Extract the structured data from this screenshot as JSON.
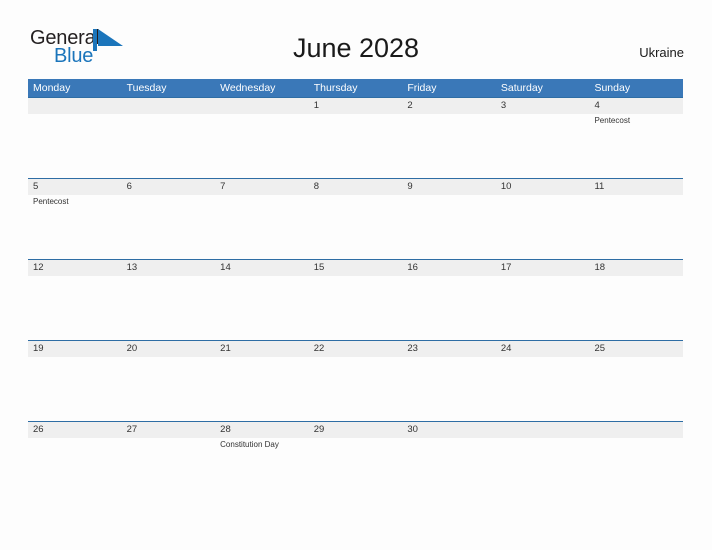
{
  "logo": {
    "part1": "General",
    "part2": "Blue",
    "mark_name": "general-blue-sail-mark",
    "color_dark": "#231f20",
    "color_blue": "#1b75bb"
  },
  "header": {
    "title": "June 2028",
    "region": "Ukraine"
  },
  "colors": {
    "header_blue": "#3a78b8",
    "row_divider_blue": "#2e6da4",
    "row_band_gray": "#efefef",
    "page_background": "#fdfdfd",
    "text": "#333333"
  },
  "calendar": {
    "weekdays": [
      "Monday",
      "Tuesday",
      "Wednesday",
      "Thursday",
      "Friday",
      "Saturday",
      "Sunday"
    ],
    "weeks": [
      [
        {
          "day": "",
          "event": ""
        },
        {
          "day": "",
          "event": ""
        },
        {
          "day": "",
          "event": ""
        },
        {
          "day": "1",
          "event": ""
        },
        {
          "day": "2",
          "event": ""
        },
        {
          "day": "3",
          "event": ""
        },
        {
          "day": "4",
          "event": "Pentecost"
        }
      ],
      [
        {
          "day": "5",
          "event": "Pentecost"
        },
        {
          "day": "6",
          "event": ""
        },
        {
          "day": "7",
          "event": ""
        },
        {
          "day": "8",
          "event": ""
        },
        {
          "day": "9",
          "event": ""
        },
        {
          "day": "10",
          "event": ""
        },
        {
          "day": "11",
          "event": ""
        }
      ],
      [
        {
          "day": "12",
          "event": ""
        },
        {
          "day": "13",
          "event": ""
        },
        {
          "day": "14",
          "event": ""
        },
        {
          "day": "15",
          "event": ""
        },
        {
          "day": "16",
          "event": ""
        },
        {
          "day": "17",
          "event": ""
        },
        {
          "day": "18",
          "event": ""
        }
      ],
      [
        {
          "day": "19",
          "event": ""
        },
        {
          "day": "20",
          "event": ""
        },
        {
          "day": "21",
          "event": ""
        },
        {
          "day": "22",
          "event": ""
        },
        {
          "day": "23",
          "event": ""
        },
        {
          "day": "24",
          "event": ""
        },
        {
          "day": "25",
          "event": ""
        }
      ],
      [
        {
          "day": "26",
          "event": ""
        },
        {
          "day": "27",
          "event": ""
        },
        {
          "day": "28",
          "event": "Constitution Day"
        },
        {
          "day": "29",
          "event": ""
        },
        {
          "day": "30",
          "event": ""
        },
        {
          "day": "",
          "event": ""
        },
        {
          "day": "",
          "event": ""
        }
      ]
    ]
  }
}
